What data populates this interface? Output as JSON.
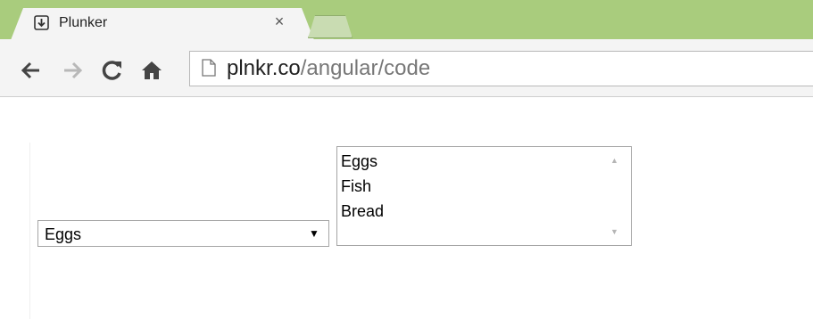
{
  "browser": {
    "tab": {
      "title": "Plunker",
      "close_glyph": "×",
      "icon": "download-arrow-icon"
    },
    "toolbar": {
      "back_icon": "back-arrow-icon",
      "forward_icon": "forward-arrow-icon",
      "reload_icon": "reload-icon",
      "home_icon": "home-icon"
    },
    "url": {
      "host": "plnkr.co",
      "path": "/angular/code",
      "page_icon": "page-icon"
    },
    "colors": {
      "tab_strip": "#a9cc7d",
      "toolbar": "#f4f4f4"
    }
  },
  "page": {
    "dropdown": {
      "selected": "Eggs",
      "arrow": "▼"
    },
    "listbox": {
      "items": [
        "Eggs",
        "Fish",
        "Bread"
      ],
      "scroll_up": "▲",
      "scroll_down": "▼"
    }
  }
}
